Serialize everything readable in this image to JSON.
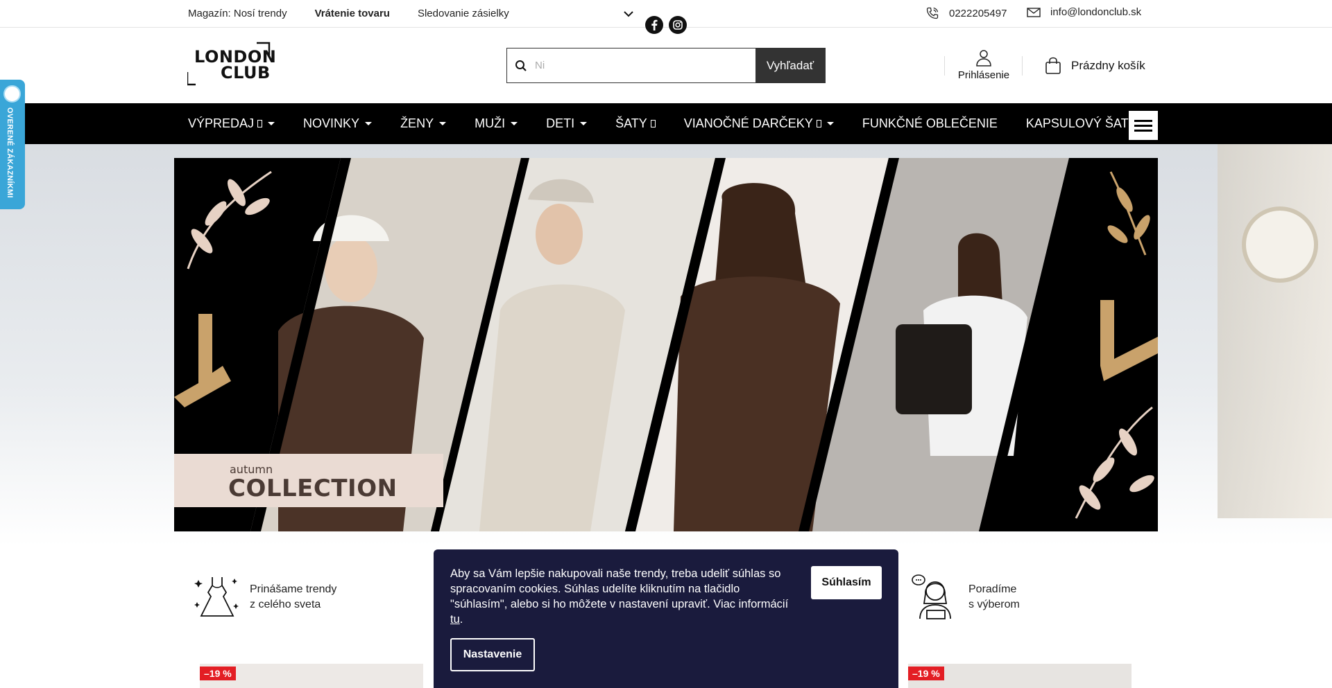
{
  "topbar": {
    "links": [
      "Magazín: Nosí trendy",
      "Vrátenie tovaru",
      "Sledovanie zásielky"
    ],
    "phone": "0222205497",
    "email": "info@londonclub.sk",
    "social_icons": [
      "facebook-icon",
      "instagram-icon"
    ]
  },
  "header": {
    "logo_line1": "LONDON",
    "logo_line2": "CLUB",
    "search_placeholder": "Ni",
    "search_button": "Vyhľadať",
    "login_label": "Prihlásenie",
    "cart_label": "Prázdny košík"
  },
  "nav": {
    "items": [
      {
        "label": "VÝPREDAJ",
        "box": true,
        "caret": true
      },
      {
        "label": "NOVINKY",
        "box": false,
        "caret": true
      },
      {
        "label": "ŽENY",
        "box": false,
        "caret": true
      },
      {
        "label": "MUŽI",
        "box": false,
        "caret": true
      },
      {
        "label": "DETI",
        "box": false,
        "caret": true
      },
      {
        "label": "ŠATY",
        "box": true,
        "caret": false
      },
      {
        "label": "VIANOČNÉ DARČEKY",
        "box": true,
        "caret": true
      },
      {
        "label": "FUNKČNÉ OBLEČENIE",
        "box": false,
        "caret": false
      },
      {
        "label": "KAPSULOVÝ ŠATNÍK",
        "box": false,
        "caret": false
      }
    ]
  },
  "hero": {
    "promo_small": "autumn",
    "promo_big": "COLLECTION"
  },
  "badge": {
    "text": "OVERENÉ ZÁKAZNÍKMI"
  },
  "features": [
    {
      "line1": "Prinášame trendy",
      "line2": "z celého sveta",
      "icon": "dress-icon"
    },
    {
      "line1": "Poradíme",
      "line2": "s výberom",
      "icon": "support-agent-icon"
    }
  ],
  "products": {
    "discount_left": "–19 %",
    "discount_right": "–19 %"
  },
  "cookie": {
    "message": "Aby sa Vám lepšie nakupovali naše trendy, treba udeliť súhlas so spracovaním cookies. Súhlas udelíte kliknutím na tlačidlo \"súhlasím\", alebo si ho môžete v nastavení upraviť. Viac informácií ",
    "link": "tu",
    "message_end": ".",
    "agree_button": "Súhlasím",
    "settings_button": "Nastavenie"
  },
  "colors": {
    "nav_bg": "#000000",
    "badge_bg": "#3aa6d8",
    "cookie_bg": "#1a1b3d",
    "discount": "#e31e24",
    "hero_gold": "#c9a26b"
  }
}
